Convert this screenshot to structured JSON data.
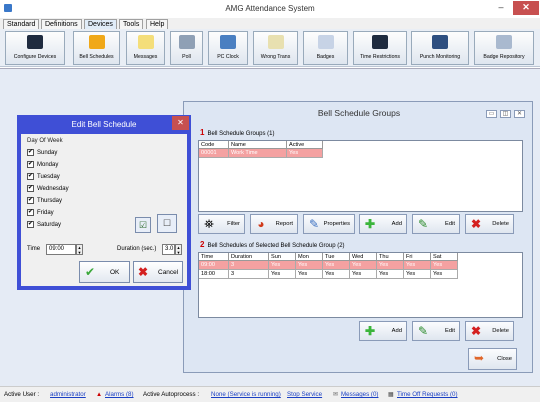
{
  "app": {
    "title": "AMG Attendance System",
    "min": "–",
    "close": "✕"
  },
  "menu": [
    "Standard",
    "Definitions",
    "Devices",
    "Tools",
    "Help"
  ],
  "toolbar": [
    "Configure Devices",
    "Bell Schedules",
    "Messages",
    "Poll",
    "PC Clock",
    "Wrong Trans",
    "Badges",
    "Time Restrictions",
    "Punch Monitoring",
    "Badge Repository"
  ],
  "bsg": {
    "title": "Bell Schedule Groups",
    "groups_num": "1",
    "groups_title": "Bell Schedule Groups (1)",
    "groups_cols": [
      "Code",
      "Name",
      "Active"
    ],
    "groups_rows": [
      [
        "00001",
        "Work Time",
        "Yes"
      ]
    ],
    "actions": {
      "filter": "Filter",
      "report": "Report",
      "properties": "Properties",
      "add": "Add",
      "edit": "Edit",
      "delete": "Delete"
    },
    "sched_num": "2",
    "sched_title": "Bell Schedules of Selected Bell Schedule Group (2)",
    "sched_cols": [
      "Time",
      "Duration",
      "Sun",
      "Mon",
      "Tue",
      "Wed",
      "Thu",
      "Fri",
      "Sat"
    ],
    "sched_rows": [
      [
        "09:00",
        "3",
        "Yes",
        "Yes",
        "Yes",
        "Yes",
        "Yes",
        "Yes",
        "Yes"
      ],
      [
        "18:00",
        "3",
        "Yes",
        "Yes",
        "Yes",
        "Yes",
        "Yes",
        "Yes",
        "Yes"
      ]
    ],
    "bottom": {
      "add": "Add",
      "edit": "Edit",
      "delete": "Delete",
      "close": "Close"
    }
  },
  "ebs": {
    "title": "Edit Bell Schedule",
    "close": "✕",
    "dow_label": "Day Of Week",
    "days": [
      "Sunday",
      "Monday",
      "Tuesday",
      "Wednesday",
      "Thursday",
      "Friday",
      "Saturday"
    ],
    "check": "✔",
    "time_label": "Time",
    "time_value": "09:00",
    "duration_label": "Duration (sec.)",
    "duration_value": "3.0",
    "ok": "OK",
    "cancel": "Cancel"
  },
  "status": {
    "active_user_label": "Active User :",
    "active_user": "administrator",
    "alarms": "Alarms (8)",
    "autoprocess_label": "Active Autoprocess :",
    "autoprocess": "None (Service is running)",
    "stop": "Stop Service",
    "messages": "Messages (0)",
    "timeoff": "Time Off Requests (0)"
  },
  "colors": {
    "accent": "#3f4fd6",
    "selected_row": "#f4a1a1",
    "close_red": "#c75050"
  }
}
